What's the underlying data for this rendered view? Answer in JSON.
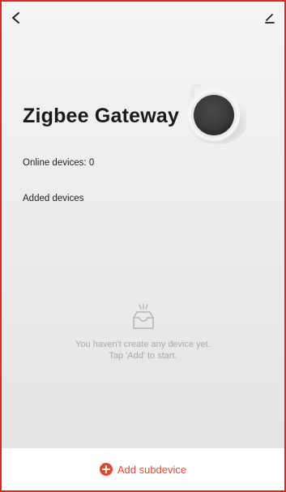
{
  "header": {
    "back_icon": "chevron-left-icon",
    "edit_icon": "pencil-icon"
  },
  "device": {
    "title": "Zigbee Gateway",
    "online_label": "Online devices: 0",
    "added_label": "Added devices"
  },
  "empty_state": {
    "icon": "empty-tray-icon",
    "line1": "You haven't create any device yet.",
    "line2": "Tap 'Add' to start."
  },
  "footer": {
    "add_label": "Add subdevice",
    "add_icon": "plus-circle-icon",
    "accent_color": "#e8452e"
  }
}
